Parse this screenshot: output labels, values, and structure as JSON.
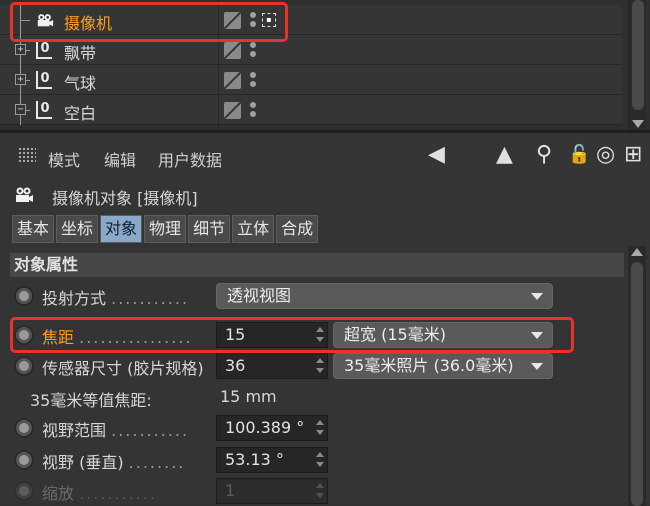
{
  "object_manager": {
    "objects": [
      {
        "label": "摄像机",
        "icon": "camera-icon",
        "expander": "",
        "active": true
      },
      {
        "label": "飘带",
        "icon": "null-object-icon",
        "expander": "+"
      },
      {
        "label": "气球",
        "icon": "null-object-icon",
        "expander": "+"
      },
      {
        "label": "空白",
        "icon": "null-object-icon",
        "expander": "−"
      }
    ],
    "null_icon_glyph": "0",
    "highlight_color": "#e8332a"
  },
  "attribute_manager": {
    "menu": {
      "mode": "模式",
      "edit": "编辑",
      "user_data": "用户数据"
    },
    "tools": {
      "back": "◀",
      "up": "▲",
      "search": "⚲",
      "lock": "🔓",
      "target": "◎",
      "new": "⊞"
    },
    "title": "摄像机对象 [摄像机]",
    "tabs": [
      "基本",
      "坐标",
      "对象",
      "物理",
      "细节",
      "立体",
      "合成"
    ],
    "active_tab": "对象",
    "section": "对象属性",
    "properties": {
      "projection": {
        "label": "投射方式",
        "dots": "...........",
        "value": "透视视图"
      },
      "focal_length": {
        "label": "焦距",
        "dots": "................",
        "value": "15",
        "preset": "超宽 (15毫米)"
      },
      "sensor_size": {
        "label": "传感器尺寸 (胶片规格)",
        "value": "36",
        "preset": "35毫米照片 (36.0毫米)"
      },
      "equiv_focal": {
        "label": "35毫米等值焦距:",
        "value": "15 mm"
      },
      "fov": {
        "label": "视野范围",
        "dots": "...........",
        "value": "100.389 °"
      },
      "fov_vertical": {
        "label": "视野 (垂直)",
        "dots": "........",
        "value": "53.13 °"
      },
      "zoom": {
        "label": "缩放",
        "dots": "...........",
        "value": "1"
      }
    },
    "accent_color": "#ff9e1a"
  }
}
